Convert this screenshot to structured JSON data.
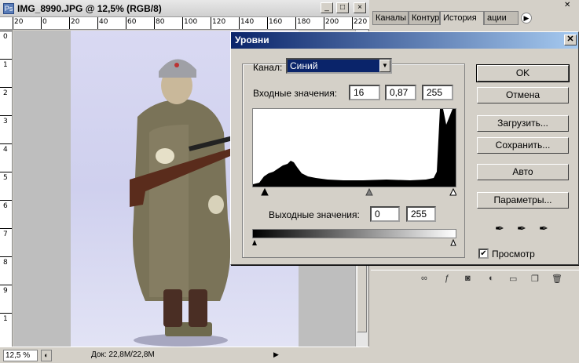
{
  "document": {
    "title": "IMG_8990.JPG @ 12,5% (RGB/8)",
    "zoom": "12,5 %",
    "doc_size": "Док: 22,8M/22,8M",
    "ruler_top_labels": [
      "20",
      "0",
      "20",
      "40",
      "60",
      "80",
      "100",
      "120",
      "140",
      "160",
      "180",
      "200",
      "220"
    ],
    "ruler_left_labels": [
      "0",
      "1",
      "2",
      "3",
      "4",
      "5",
      "6",
      "7",
      "8",
      "9",
      "1"
    ]
  },
  "panel": {
    "tabs": [
      "Каналы",
      "Контур",
      "История",
      "ации"
    ],
    "active_tab": "История"
  },
  "dialog": {
    "title": "Уровни",
    "channel_label": "Канал:",
    "channel_value": "Синий",
    "input_label": "Входные значения:",
    "input_values": [
      "16",
      "0,87",
      "255"
    ],
    "output_label": "Выходные значения:",
    "output_values": [
      "0",
      "255"
    ],
    "buttons": {
      "ok": "OK",
      "cancel": "Отмена",
      "load": "Загрузить...",
      "save": "Сохранить...",
      "auto": "Авто",
      "options": "Параметры..."
    },
    "preview_label": "Просмотр",
    "preview_checked": true
  },
  "colors": {
    "dialog_title_start": "#0a246a",
    "dialog_title_end": "#a6caf0",
    "selection": "#0a246a"
  }
}
